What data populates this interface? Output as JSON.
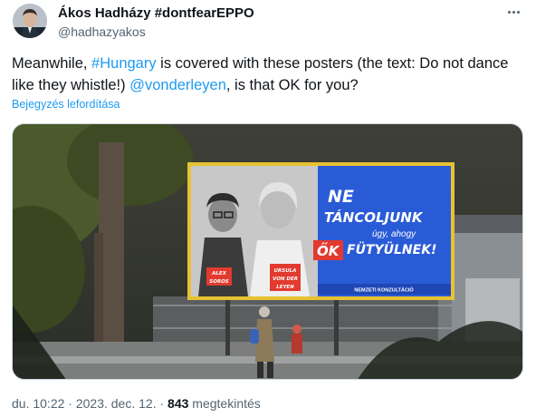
{
  "author": {
    "name": "Ákos Hadházy #dontfearEPPO",
    "handle": "@hadhazyakos"
  },
  "tweet": {
    "text_part1": "Meanwhile, ",
    "hashtag": "#Hungary",
    "text_part2": " is covered with these posters (the text: Do not dance like they whistle!) ",
    "mention": "@vonderleyen",
    "text_part3": ", is that OK for you?",
    "translate_label": "Bejegyzés lefordítása"
  },
  "poster": {
    "line1": "NE",
    "line2": "TÁNCOLJUNK",
    "line3": "úgy, ahogy",
    "line4_highlight": "ŐK",
    "line4_rest": "FÜTYÜLNEK!",
    "tag_left_1": "ALEX",
    "tag_left_2": "SOROS",
    "tag_right_1": "URSULA",
    "tag_right_2": "VON DER",
    "tag_right_3": "LEYEN",
    "bottom_strip": "NEMZETI KONZULTÁCIÓ"
  },
  "footer": {
    "time": "du. 10:22",
    "sep1": " · ",
    "date": "2023. dec. 12.",
    "sep2": " · ",
    "views_count": "843",
    "views_label": " megtekintés"
  },
  "icons": {
    "more": "more-dots-icon",
    "avatar": "avatar"
  },
  "colors": {
    "link": "#1d9bf0",
    "billboard_blue": "#2a5bd7",
    "billboard_red": "#e23a2f",
    "billboard_frame": "#e7c232"
  }
}
